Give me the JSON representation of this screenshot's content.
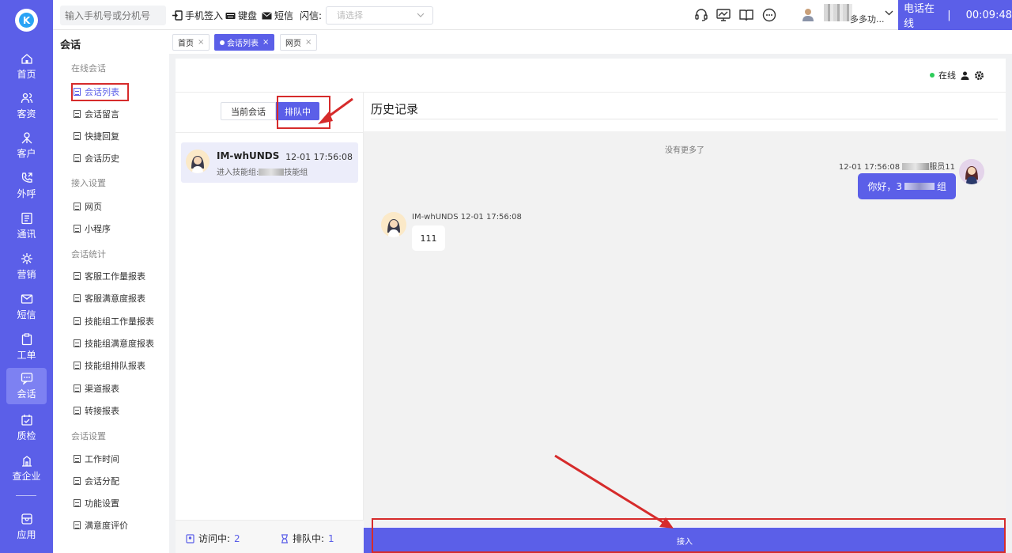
{
  "rail": {
    "items": [
      {
        "label": "首页",
        "icon": "home-icon"
      },
      {
        "label": "客资",
        "icon": "users-icon"
      },
      {
        "label": "客户",
        "icon": "customer-icon"
      },
      {
        "label": "外呼",
        "icon": "outbound-call-icon"
      },
      {
        "label": "通讯",
        "icon": "contacts-icon"
      },
      {
        "label": "营销",
        "icon": "marketing-icon"
      },
      {
        "label": "短信",
        "icon": "sms-icon"
      },
      {
        "label": "工单",
        "icon": "clipboard-icon"
      },
      {
        "label": "会话",
        "icon": "chat-icon",
        "active": true
      },
      {
        "label": "质检",
        "icon": "inspection-icon"
      },
      {
        "label": "查企业",
        "icon": "building-icon"
      },
      {
        "label": "应用",
        "icon": "apps-icon"
      }
    ]
  },
  "topbar": {
    "search_placeholder": "输入手机号或分机号",
    "checkin_label": "手机签入",
    "keyboard_label": "键盘",
    "sms_label": "短信",
    "flash_label": "闪信:",
    "flash_placeholder": "请选择",
    "user_name": "多多功...",
    "phone_status": "电话在线",
    "phone_sep": "|",
    "timer": "00:09:48"
  },
  "submenu": {
    "title": "会话",
    "groups": [
      {
        "label": "在线会话",
        "items": [
          "会话列表",
          "会话留言",
          "快捷回复",
          "会话历史"
        ]
      },
      {
        "label": "接入设置",
        "items": [
          "网页",
          "小程序"
        ]
      },
      {
        "label": "会话统计",
        "items": [
          "客服工作量报表",
          "客服满意度报表",
          "技能组工作量报表",
          "技能组满意度报表",
          "技能组排队报表",
          "渠道报表",
          "转接报表"
        ]
      },
      {
        "label": "会话设置",
        "items": [
          "工作时间",
          "会话分配",
          "功能设置",
          "满意度评价"
        ]
      }
    ],
    "active_item": "会话列表"
  },
  "tabs": [
    {
      "label": "首页",
      "close": "×"
    },
    {
      "label": "会话列表",
      "close": "×",
      "active": true
    },
    {
      "label": "网页",
      "close": "×"
    }
  ],
  "panel": {
    "online_label": "在线",
    "segment": {
      "current": "当前会话",
      "queue": "排队中"
    },
    "session": {
      "name": "IM-whUNDS",
      "time": "12-01 17:56:08",
      "message_prefix": "进入技能组:",
      "message_suffix": "技能组"
    },
    "footer": {
      "visiting_label": "访问中:",
      "visiting_count": "2",
      "queue_label": "排队中:",
      "queue_count": "1"
    },
    "history": {
      "title": "历史记录",
      "no_more": "没有更多了",
      "agent_meta_time": "12-01 17:56:08",
      "agent_meta_suffix": "服员11",
      "agent_msg_prefix": "你好，3",
      "agent_msg_suffix": "组",
      "customer_meta": "IM-whUNDS 12-01 17:56:08",
      "customer_msg": "111"
    },
    "accept_label": "接入"
  },
  "colors": {
    "accent": "#5b5fe8",
    "annotation": "#d62b2b",
    "online": "#2ecc5a"
  }
}
